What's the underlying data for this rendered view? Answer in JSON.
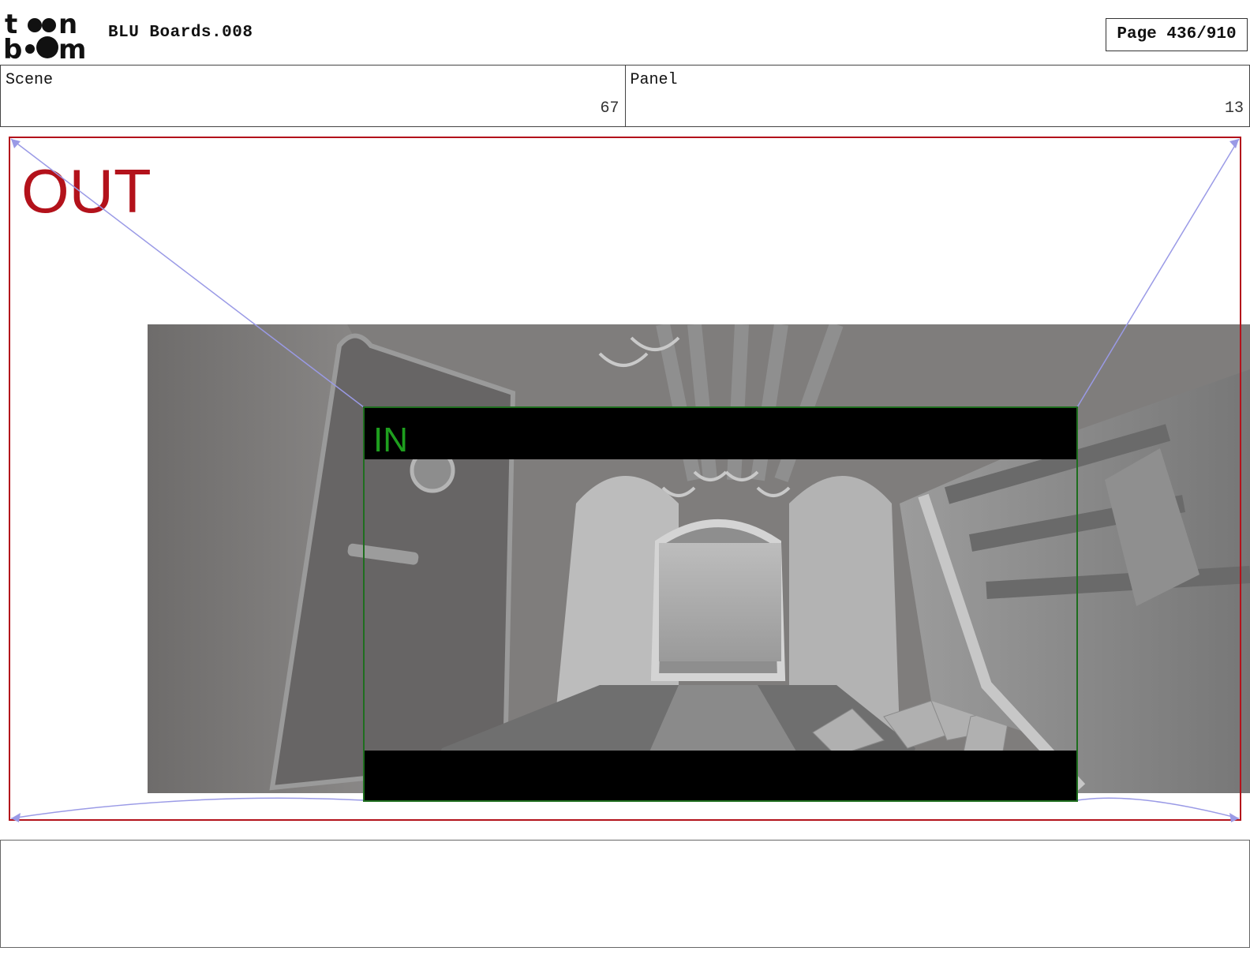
{
  "header": {
    "logo_text_top": "t",
    "logo_text_top2": "n",
    "logo_text_bottom": "b",
    "logo_text_bottom2": "m",
    "document_title": "BLU Boards.008",
    "page_label": "Page 436/910"
  },
  "info": {
    "scene_label": "Scene",
    "scene_value": "67",
    "panel_label": "Panel",
    "panel_value": "13"
  },
  "frame": {
    "out_label": "OUT",
    "in_label": "IN",
    "out_color": "#b3121b",
    "in_color": "#1e9e1e",
    "guide_color": "#9a9ae6"
  },
  "notes": {
    "text": ""
  }
}
